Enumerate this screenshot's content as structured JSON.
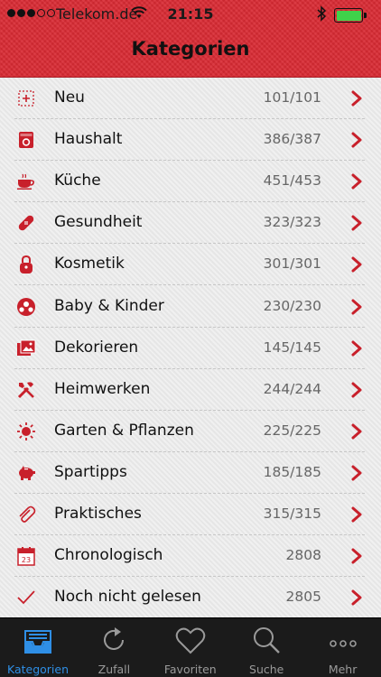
{
  "status_bar": {
    "carrier": "Telekom.de",
    "time": "21:15"
  },
  "nav": {
    "title": "Kategorien"
  },
  "categories": [
    {
      "label": "Neu",
      "count": "101/101",
      "icon": "new-box-icon"
    },
    {
      "label": "Haushalt",
      "count": "386/387",
      "icon": "washing-machine-icon"
    },
    {
      "label": "Küche",
      "count": "451/453",
      "icon": "coffee-cup-icon"
    },
    {
      "label": "Gesundheit",
      "count": "323/323",
      "icon": "bandage-icon"
    },
    {
      "label": "Kosmetik",
      "count": "301/301",
      "icon": "cosmetics-icon"
    },
    {
      "label": "Baby & Kinder",
      "count": "230/230",
      "icon": "ball-icon"
    },
    {
      "label": "Dekorieren",
      "count": "145/145",
      "icon": "pictures-icon"
    },
    {
      "label": "Heimwerken",
      "count": "244/244",
      "icon": "tools-icon"
    },
    {
      "label": "Garten & Pflanzen",
      "count": "225/225",
      "icon": "sun-icon"
    },
    {
      "label": "Spartipps",
      "count": "185/185",
      "icon": "piggy-bank-icon"
    },
    {
      "label": "Praktisches",
      "count": "315/315",
      "icon": "paperclip-icon"
    },
    {
      "label": "Chronologisch",
      "count": "2808",
      "icon": "calendar-icon"
    },
    {
      "label": "Noch nicht gelesen",
      "count": "2805",
      "icon": "checkmark-icon"
    }
  ],
  "tabs": [
    {
      "label": "Kategorien",
      "icon": "inbox-tray-icon",
      "active": true
    },
    {
      "label": "Zufall",
      "icon": "refresh-icon",
      "active": false
    },
    {
      "label": "Favoriten",
      "icon": "heart-icon",
      "active": false
    },
    {
      "label": "Suche",
      "icon": "search-icon",
      "active": false
    },
    {
      "label": "Mehr",
      "icon": "more-dots-icon",
      "active": false
    }
  ],
  "colors": {
    "accent_red": "#d92a33",
    "icon_red": "#c8202b",
    "tab_active": "#2f8fe6",
    "tab_inactive": "#9a9a9a"
  }
}
